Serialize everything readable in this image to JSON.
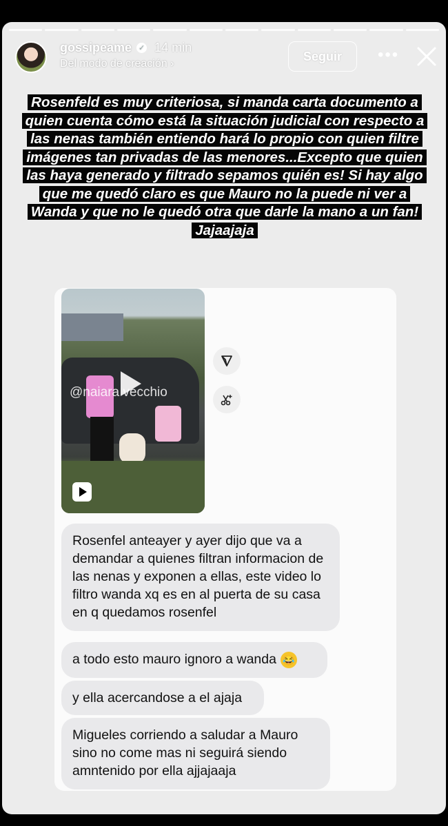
{
  "header": {
    "username": "gossipeame",
    "time": "14 min",
    "subtitle": "Del modo de creación",
    "follow_label": "Seguir",
    "more_label": "•••"
  },
  "caption": "Rosenfeld es muy criteriosa, si manda carta documento a quien cuenta cómo está la situación judicial con respecto a las nenas también entiendo hará lo propio con quien filtre imágenes tan privadas de las menores...Excepto que quien las haya generado y filtrado sepamos quién es! Si hay algo que me quedó claro es que Mauro no la puede ni ver a Wanda y que no le quedó otra que darle la mano a un fan! Jajaajaja",
  "video": {
    "watermark": "@naiara vecchio"
  },
  "messages": [
    {
      "text": "Rosenfel anteayer y ayer dijo que va a demandar a quienes filtran informacion de las nenas y exponen a ellas, este video lo filtro wanda xq es en al puerta de su casa en q quedamos rosenfel"
    },
    {
      "text": "a todo esto mauro ignoro a wanda"
    },
    {
      "text": "y ella acercandose a el ajaja"
    },
    {
      "text": "Migueles corriendo a saludar a Mauro sino no come mas ni seguirá siendo amntenido por ella ajjajaaja"
    }
  ],
  "icons": {
    "laugh": "😂"
  },
  "colors": {
    "story_background": "#ececec",
    "caption_background": "#050505",
    "bubble_background": "#e9e9eb"
  }
}
